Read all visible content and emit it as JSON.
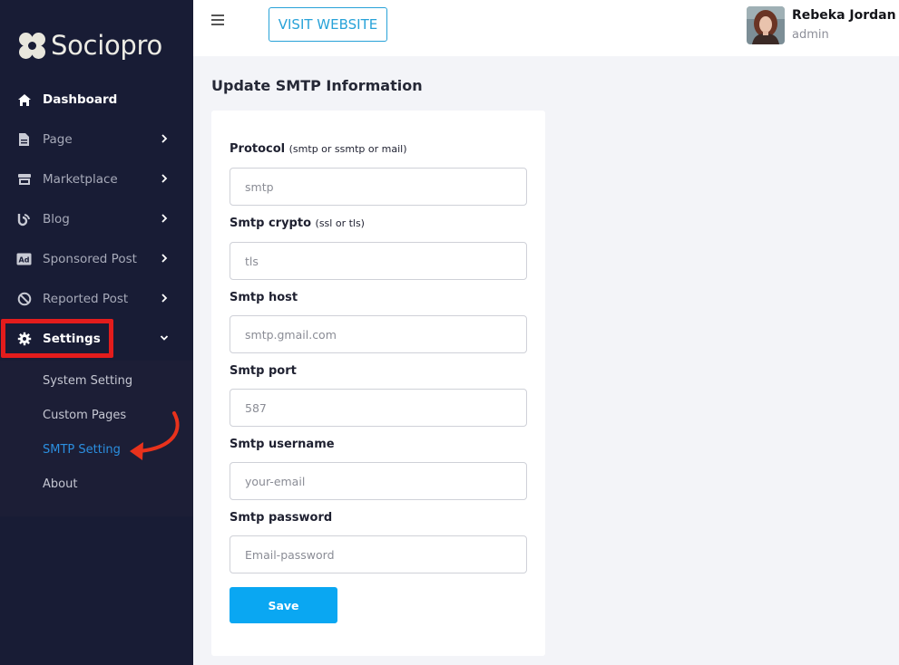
{
  "brand": {
    "name": "Sociopro"
  },
  "sidebar": {
    "items": [
      {
        "label": "Dashboard",
        "icon": "home-icon"
      },
      {
        "label": "Page",
        "icon": "file-icon"
      },
      {
        "label": "Marketplace",
        "icon": "store-icon"
      },
      {
        "label": "Blog",
        "icon": "blog-icon"
      },
      {
        "label": "Sponsored Post",
        "icon": "ad-icon"
      },
      {
        "label": "Reported Post",
        "icon": "ban-icon"
      },
      {
        "label": "Settings",
        "icon": "gear-icon"
      }
    ],
    "submenu": [
      {
        "label": "System Setting"
      },
      {
        "label": "Custom Pages"
      },
      {
        "label": "SMTP Setting"
      },
      {
        "label": "About"
      }
    ]
  },
  "topbar": {
    "visit_label": "VISIT WEBSITE",
    "user_name": "Rebeka Jordan",
    "user_role": "admin"
  },
  "main": {
    "title": "Update SMTP Information",
    "fields": [
      {
        "label": "Protocol",
        "hint": "(smtp or ssmtp or mail)",
        "value": "smtp"
      },
      {
        "label": "Smtp crypto",
        "hint": "(ssl or tls)",
        "value": "tls"
      },
      {
        "label": "Smtp host",
        "hint": "",
        "value": "smtp.gmail.com"
      },
      {
        "label": "Smtp port",
        "hint": "",
        "value": "587"
      },
      {
        "label": "Smtp username",
        "hint": "",
        "value": "your-email"
      },
      {
        "label": "Smtp password",
        "hint": "",
        "value": "Email-password"
      }
    ],
    "save_label": "Save"
  },
  "colors": {
    "sidebar_bg": "#181c35",
    "accent": "#0aa7f2",
    "link_active": "#2b8fe0",
    "highlight": "#e31c1c"
  }
}
